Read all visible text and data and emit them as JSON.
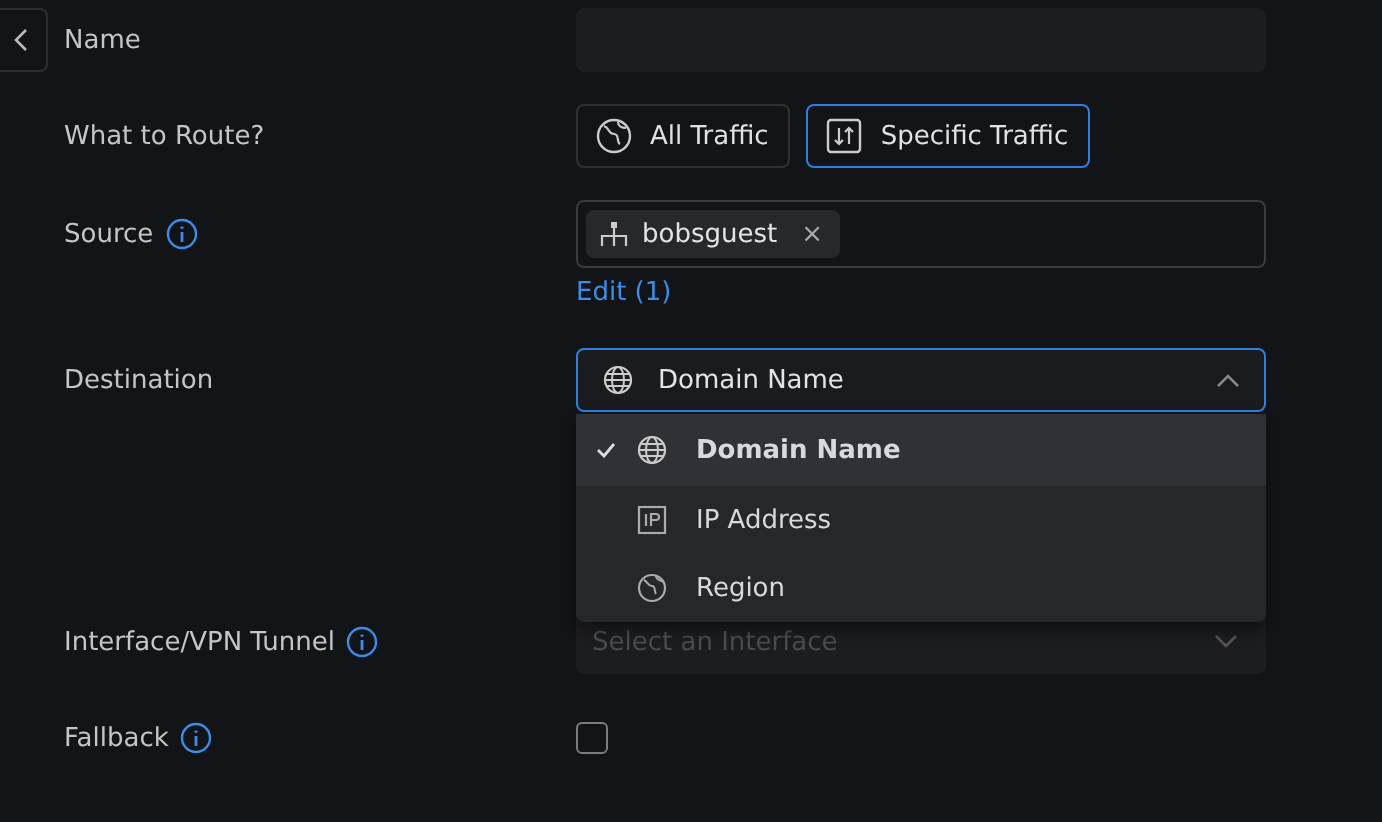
{
  "name": {
    "label": "Name"
  },
  "route": {
    "label": "What to Route?",
    "options": [
      {
        "label": "All Traffic",
        "kind": "globe",
        "selected": false
      },
      {
        "label": "Specific Traffic",
        "kind": "arrows",
        "selected": true
      }
    ]
  },
  "source": {
    "label": "Source",
    "chips": [
      {
        "label": "bobsguest",
        "remove": "×"
      }
    ],
    "edit_link": "Edit (1)"
  },
  "destination": {
    "label": "Destination",
    "value": "Domain Name",
    "expanded": true,
    "menu": [
      {
        "label": "Domain Name",
        "kind": "globe",
        "selected": true
      },
      {
        "label": "IP Address",
        "kind": "ip",
        "selected": false
      },
      {
        "label": "Region",
        "kind": "region",
        "selected": false
      }
    ]
  },
  "interface": {
    "label": "Interface/VPN Tunnel",
    "placeholder": "Select an Interface"
  },
  "fallback": {
    "label": "Fallback",
    "checked": false
  }
}
